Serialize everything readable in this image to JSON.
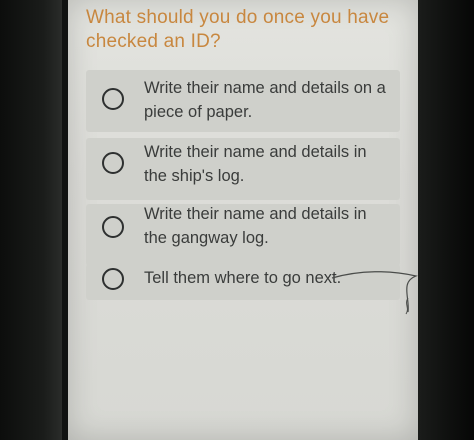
{
  "quiz": {
    "question": "What should you do once you have checked an ID?",
    "options": [
      {
        "label": "Write their name and details on a piece of paper.",
        "selected": false
      },
      {
        "label": "Write their name and details in the ship's log.",
        "selected": false
      },
      {
        "label": "Write their name and details in the gangway log.",
        "selected": false
      },
      {
        "label": "Tell them where to go next.",
        "selected": false
      }
    ]
  },
  "colors": {
    "question_text": "#c8873f",
    "option_text": "#3a3c3b",
    "option_background": "#cfd0cb",
    "screen_background": "#dcdcd8"
  },
  "icons": {
    "option_marker": "radio-button-icon"
  }
}
